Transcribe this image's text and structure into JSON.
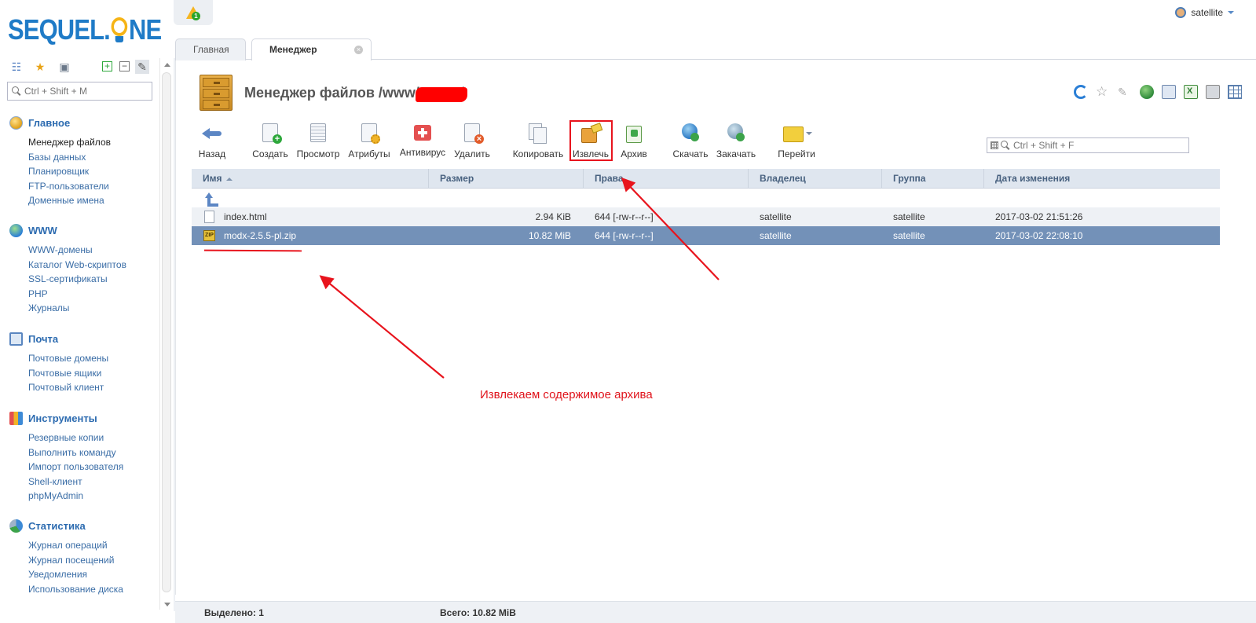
{
  "app": {
    "logo_left": "SEQUEL",
    "logo_right": "NE",
    "sidebar_search_placeholder": "Ctrl + Shift + M",
    "alert_count": "1",
    "user_name": "satellite"
  },
  "tabs": [
    {
      "label": "Главная"
    },
    {
      "label": "Менеджер файлов",
      "close": "×"
    }
  ],
  "sidebar": {
    "groups": [
      {
        "title": "Главное",
        "items": [
          "Менеджер файлов",
          "Базы данных",
          "Планировщик",
          "FTP-пользователи",
          "Доменные имена"
        ],
        "active": 0
      },
      {
        "title": "WWW",
        "items": [
          "WWW-домены",
          "Каталог Web-скриптов",
          "SSL-сертификаты",
          "PHP",
          "Журналы"
        ]
      },
      {
        "title": "Почта",
        "items": [
          "Почтовые домены",
          "Почтовые ящики",
          "Почтовый клиент"
        ]
      },
      {
        "title": "Инструменты",
        "items": [
          "Резервные копии",
          "Выполнить команду",
          "Импорт пользователя",
          "Shell-клиент",
          "phpMyAdmin"
        ]
      },
      {
        "title": "Статистика",
        "items": [
          "Журнал операций",
          "Журнал посещений",
          "Уведомления",
          "Использование диска"
        ]
      }
    ]
  },
  "page": {
    "title": "Менеджер файлов /www/",
    "title_tail": "/",
    "grid_search_placeholder": "Ctrl + Shift + F"
  },
  "toolbar": [
    {
      "label": "Назад",
      "icon": "back-arrow-icon"
    },
    {
      "label": "Создать",
      "icon": "create-file-icon"
    },
    {
      "label": "Просмотр",
      "icon": "view-icon"
    },
    {
      "label": "Атрибуты",
      "icon": "attributes-icon"
    },
    {
      "label": "Антивирус",
      "icon": "antivirus-icon"
    },
    {
      "label": "Удалить",
      "icon": "delete-icon"
    },
    {
      "label": "Копировать",
      "icon": "copy-icon"
    },
    {
      "label": "Извлечь",
      "icon": "extract-icon"
    },
    {
      "label": "Архив",
      "icon": "archive-icon"
    },
    {
      "label": "Скачать",
      "icon": "download-icon"
    },
    {
      "label": "Закачать",
      "icon": "upload-icon"
    },
    {
      "label": "Перейти",
      "icon": "goto-folder-icon"
    }
  ],
  "grid": {
    "columns": [
      "Имя",
      "Размер",
      "Права",
      "Владелец",
      "Группа",
      "Дата изменения"
    ],
    "rows": [
      {
        "name": "index.html",
        "size": "2.94 KiB",
        "perms": "644 [-rw-r--r--]",
        "owner": "satellite",
        "group": "satellite",
        "date": "2017-03-02 21:51:26",
        "type": "file"
      },
      {
        "name": "modx-2.5.5-pl.zip",
        "size": "10.82 MiB",
        "perms": "644 [-rw-r--r--]",
        "owner": "satellite",
        "group": "satellite",
        "date": "2017-03-02 22:08:10",
        "type": "zip",
        "selected": true
      }
    ]
  },
  "annotation": {
    "text": "Извлекаем содержимое архива",
    "color": "#e0141c"
  },
  "status": {
    "selected": "Выделено: 1",
    "total": "Всего: 10.82 MiB"
  },
  "colors": {
    "accent": "#2c6bb0",
    "selected_row": "#7391b8",
    "highlight": "#e8141d"
  }
}
